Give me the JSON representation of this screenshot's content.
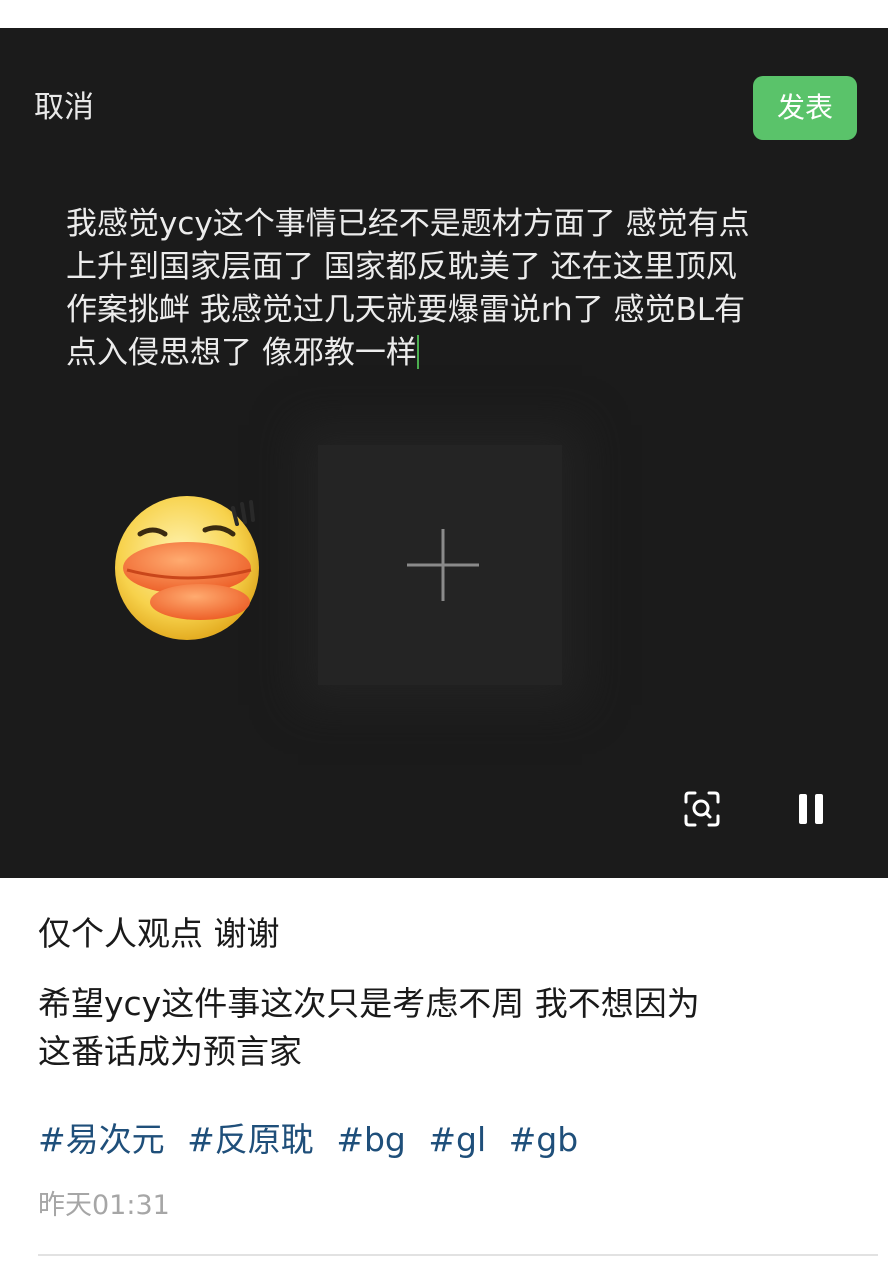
{
  "composer": {
    "cancel_label": "取消",
    "publish_label": "发表",
    "draft_text": "我感觉ycy这个事情已经不是题材方面了 感觉有点\n上升到国家层面了 国家都反耽美了 还在这里顶风\n作案挑衅 我感觉过几天就要爆雷说rh了 感觉BL有\n点入侵思想了 像邪教一样",
    "accent_color": "#5ac36a"
  },
  "icons": {
    "sticker": "duck-face-sticker",
    "add_image": "plus-icon",
    "scan": "scan-search-icon",
    "pause": "pause-icon"
  },
  "post": {
    "line1": "仅个人观点 谢谢",
    "line2": "希望ycy这件事这次只是考虑不周 我不想因为",
    "line3": "这番话成为预言家",
    "hashtags": [
      "#易次元",
      "#反原耽",
      "#bg",
      "#gl",
      "#gb"
    ],
    "timestamp": "昨天01:31",
    "hashtag_color": "#1f4f7a"
  }
}
